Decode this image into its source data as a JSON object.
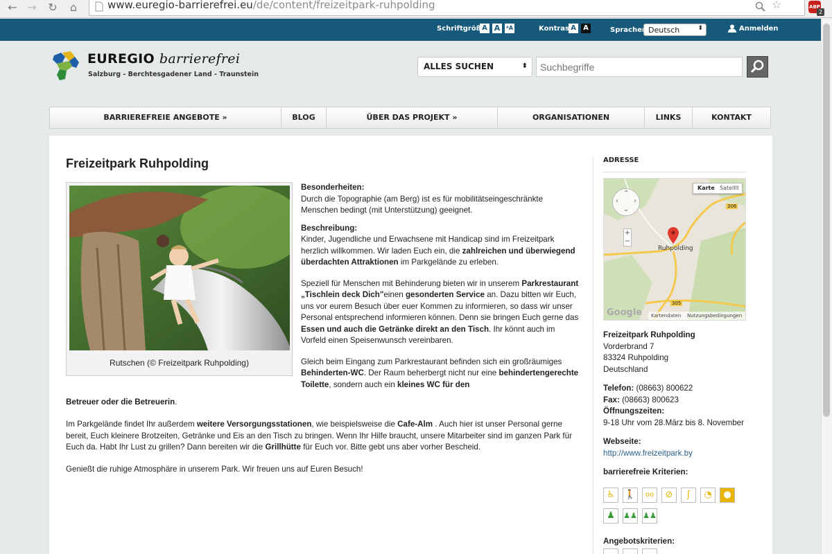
{
  "browser": {
    "url_host": "www.euregio-barrierefrei.eu",
    "url_path": "/de/content/freizeitpark-ruhpolding",
    "ext_badge": "ABP",
    "ext_count": "2"
  },
  "topbar": {
    "fontsize_label": "Schriftgröße:",
    "font_a1": "A",
    "font_a2": "A",
    "font_a3": "ᴬA",
    "contrast_label": "Kontrast:",
    "contrast_a1": "A",
    "contrast_a2": "A",
    "lang_label": "Sprachen",
    "lang_value": "Deutsch",
    "login": "Anmelden"
  },
  "logo": {
    "title": "EUREGIO",
    "title_italic": "barrierefrei",
    "subtitle": "Salzburg - Berchtesgadener Land - Traunstein"
  },
  "search": {
    "scope": "ALLES SUCHEN",
    "placeholder": "Suchbegriffe"
  },
  "nav": [
    {
      "label": "BARRIEREFREIE ANGEBOTE  »"
    },
    {
      "label": "BLOG"
    },
    {
      "label": "ÜBER DAS PROJEKT  »"
    },
    {
      "label": "ORGANISATIONEN"
    },
    {
      "label": "LINKS"
    },
    {
      "label": "KONTAKT"
    }
  ],
  "page": {
    "title": "Freizeitpark Ruhpolding",
    "image_caption": "Rutschen (© Freizeitpark Ruhpolding)",
    "besonder_head": "Besonderheiten:",
    "besonder_text": "Durch die Topographie (am Berg) ist es für mobilitätseingeschränkte Menschen bedingt (mit Unterstützung) geeignet.",
    "beschr_head": "Beschreibung:",
    "p1_a": "Kinder, Jugendliche und Erwachsene mit Handicap sind im Freizeitpark herzlich willkommen. Wir laden Euch ein,  die ",
    "p1_b": "zahlreichen und überwiegend überdachten Attraktionen",
    "p1_c": " im Parkgelände zu erleben.",
    "p2_a": "Speziell für Menschen mit Behinderung bieten wir in unserem ",
    "p2_b": "Parkrestaurant „Tischlein deck Dich\"",
    "p2_c": "einen ",
    "p2_d": "gesonderten Service",
    "p2_e": " an. Dazu bitten wir Euch, uns vor eurem Besuch über euer Kommen zu informieren, so dass wir unser Personal entsprechend informieren können. Denn sie bringen Euch gerne das ",
    "p2_f": "Essen und auch die Getränke direkt an den Tisch",
    "p2_g": ". Ihr könnt auch im  Vorfeld einen Speisenwunsch vereinbaren.",
    "p3_a": "Gleich beim Eingang zum Parkrestaurant befinden sich ein großräumiges ",
    "p3_b": "Behinderten-WC",
    "p3_c": ". Der Raum beherbergt nicht nur eine ",
    "p3_d": "behindertengerechte Toilette",
    "p3_e": ", sondern auch ein ",
    "p3_f": "kleines WC für den",
    "p3_g": "Betreuer oder die Betreuerin",
    "p3_h": ".",
    "p4_a": "Im Parkgelände findet Ihr außerdem ",
    "p4_b": "weitere Versorgungsstationen",
    "p4_c": ", wie beispielsweise die  ",
    "p4_d": "Cafe-Alm",
    "p4_e": " . Auch hier ist unser Personal gerne bereit, Euch kleinere Brotzeiten, Getränke und Eis an den Tisch zu bringen. Wenn Ihr Hilfe braucht, unsere Mitarbeiter sind im ganzen Park für Euch da. Habt Ihr Lust zu grillen? Dann bereiten wir die ",
    "p4_f": "Grillhütte",
    "p4_g": " für Euch vor. Bitte gebt uns aber vorher Bescheid.",
    "p5": "Genießt die ruhige Atmosphäre in unserem Park. Wir freuen uns auf Euren Besuch!"
  },
  "sidebar": {
    "address_head": "ADRESSE",
    "map_btn_karte": "Karte",
    "map_btn_satellit": "Satellit",
    "map_place": "Ruhpolding",
    "map_road1": "306",
    "map_road2": "305",
    "map_attr1": "Kartendaten",
    "map_attr2": "Nutzungsbedingungen",
    "map_google": "Google",
    "map_zoom_in": "+",
    "map_zoom_out": "−",
    "name": "Freizeitpark Ruhpolding",
    "street": "Vorderbrand 7",
    "city": "83324 Ruhpolding",
    "country": "Deutschland",
    "phone_label": "Telefon:",
    "phone": " (08663) 800622",
    "fax_label": "Fax:",
    "fax": " (08663) 800623",
    "hours_label": "Öffnungszeiten:",
    "hours": "9-18 Uhr vom 28.März bis 8. November",
    "web_label": "Webseite:",
    "web": "http://www.freizeitpark.by",
    "criteria_label": "barrierefreie Kriterien:",
    "offers_label": "Angebotskriterien:"
  },
  "colors": {
    "topbar": "#16597a",
    "criteria_yellow": "#e8b400",
    "criteria_green": "#3a9a3a"
  }
}
